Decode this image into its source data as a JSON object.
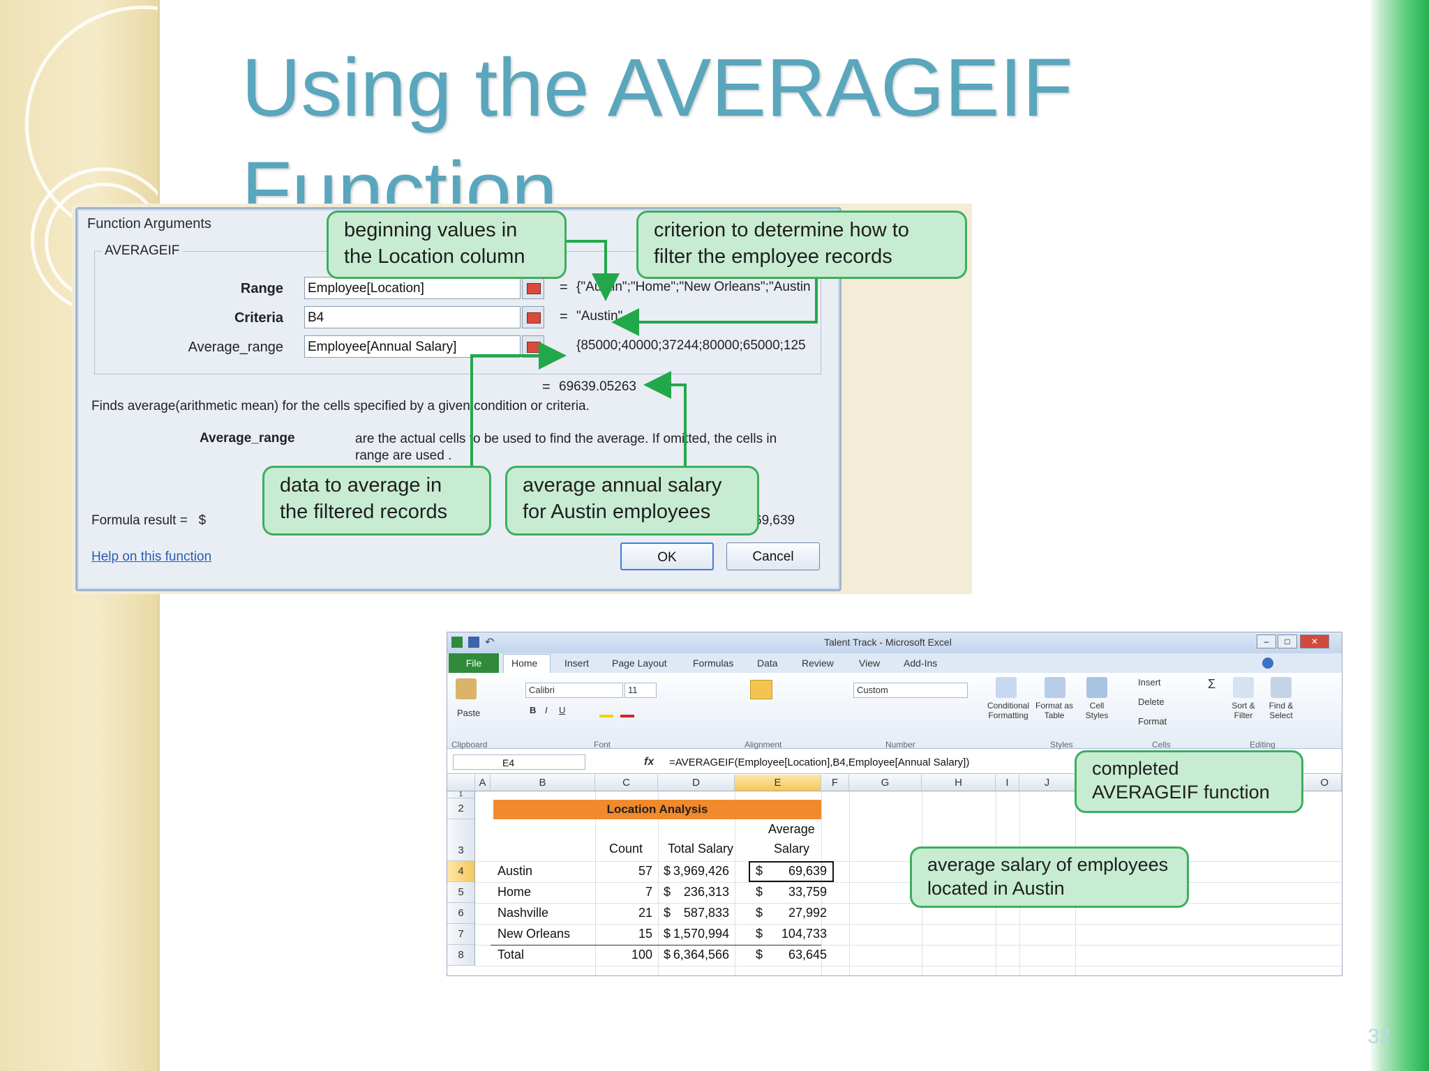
{
  "slide": {
    "title": "Using the AVERAGEIF\nFunction",
    "page_number": "32"
  },
  "dialog": {
    "title": "Function Arguments",
    "group": "AVERAGEIF",
    "args": [
      {
        "label": "Range",
        "value": "Employee[Location]",
        "eq": "=",
        "result": "{\"Austin\";\"Home\";\"New Orleans\";\"Austin"
      },
      {
        "label": "Criteria",
        "value": "B4",
        "eq": "=",
        "result": "\"Austin\""
      },
      {
        "label": "Average_range",
        "value": "Employee[Annual Salary]",
        "eq": "=",
        "result": "{85000;40000;37244;80000;65000;125"
      }
    ],
    "result_eq": "=",
    "result_value": "69639.05263",
    "description": "Finds average(arithmetic mean) for the cells specified by a given condition or criteria.",
    "arg_desc_label": "Average_range",
    "arg_desc_text": "are the actual cells to be used to find the average. If omitted, the cells in range are used .",
    "formula_result_label": "Formula result =",
    "formula_result_currency": "$",
    "formula_result_value": "69,639",
    "help_link": "Help on this function",
    "ok": "OK",
    "cancel": "Cancel"
  },
  "callouts": {
    "location": "beginning values in the Location column",
    "criterion": "criterion to determine how to filter the employee records",
    "data": "data to average in the filtered records",
    "average": "average annual salary for Austin employees",
    "completed": "completed AVERAGEIF function",
    "austin": "average salary of employees located in Austin"
  },
  "excel": {
    "title": "Talent Track - Microsoft Excel",
    "tabs": [
      "File",
      "Home",
      "Insert",
      "Page Layout",
      "Formulas",
      "Data",
      "Review",
      "View",
      "Add-Ins"
    ],
    "ribbon": {
      "paste": "Paste",
      "font_name": "Calibri",
      "font_size": "11",
      "number_format": "Custom",
      "conditional": "Conditional Formatting",
      "format_table": "Format as Table",
      "cell_styles": "Cell Styles",
      "insert": "Insert",
      "delete": "Delete",
      "format": "Format",
      "sort": "Sort & Filter",
      "find": "Find & Select",
      "groups": [
        "Clipboard",
        "Font",
        "Alignment",
        "Number",
        "Styles",
        "Cells",
        "Editing"
      ]
    },
    "name_box": "E4",
    "fx": "fx",
    "formula": "=AVERAGEIF(Employee[Location],B4,Employee[Annual Salary])",
    "columns": [
      "A",
      "B",
      "C",
      "D",
      "E",
      "F",
      "G",
      "H",
      "I",
      "J",
      "O"
    ],
    "rows": [
      "1",
      "2",
      "3",
      "4",
      "5",
      "6",
      "7",
      "8"
    ],
    "table": {
      "heading": "Location Analysis",
      "col_count": "Count",
      "col_total": "Total Salary",
      "col_avg_1": "Average",
      "col_avg_2": "Salary",
      "data": [
        {
          "loc": "Austin",
          "count": "57",
          "total_cur": "$",
          "total": "3,969,426",
          "avg_cur": "$",
          "avg": "69,639"
        },
        {
          "loc": "Home",
          "count": "7",
          "total_cur": "$",
          "total": "236,313",
          "avg_cur": "$",
          "avg": "33,759"
        },
        {
          "loc": "Nashville",
          "count": "21",
          "total_cur": "$",
          "total": "587,833",
          "avg_cur": "$",
          "avg": "27,992"
        },
        {
          "loc": "New Orleans",
          "count": "15",
          "total_cur": "$",
          "total": "1,570,994",
          "avg_cur": "$",
          "avg": "104,733"
        },
        {
          "loc": "Total",
          "count": "100",
          "total_cur": "$",
          "total": "6,364,566",
          "avg_cur": "$",
          "avg": "63,645"
        }
      ]
    }
  },
  "colors": {
    "title": "#5aa6bd",
    "callout_fill": "#c7ecd2",
    "callout_border": "#3dae5e",
    "arrow": "#22a84a",
    "table_header": "#f08a2c"
  }
}
